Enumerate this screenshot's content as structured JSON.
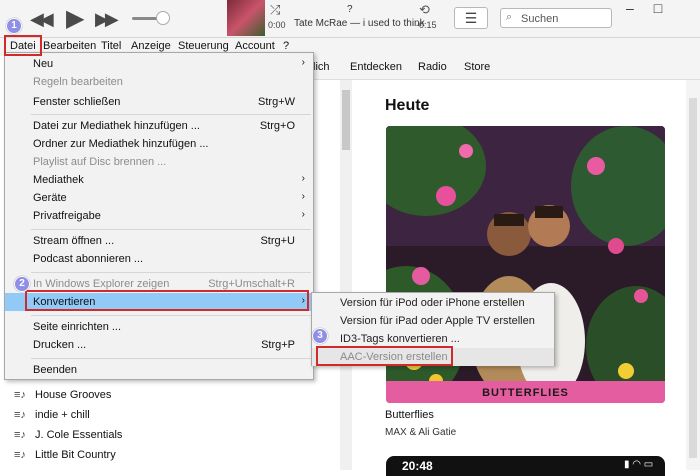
{
  "player": {
    "now_playing": "Tate McRae — i used to think",
    "track_status": "?",
    "elapsed": "0:00",
    "remaining": "-0:15",
    "search_placeholder": "Suchen"
  },
  "menubar": [
    "Datei",
    "Bearbeiten",
    "Titel",
    "Anzeige",
    "Steuerung",
    "Account",
    "?"
  ],
  "nav_tabs": [
    "lich",
    "Entdecken",
    "Radio",
    "Store"
  ],
  "main": {
    "section_title": "Heute",
    "album_cover_text": "BUTTERFLIES",
    "album_title": "Butterflies",
    "album_artist": "MAX & Ali Gatie",
    "phone_time": "20:48"
  },
  "playlists": [
    "House Grooves",
    "indie + chill",
    "J. Cole Essentials",
    "Little Bit Country"
  ],
  "file_menu": {
    "items": [
      {
        "label": "Neu",
        "shortcut": "",
        "submenu": true,
        "disabled": false
      },
      {
        "label": "Regeln bearbeiten",
        "shortcut": "",
        "submenu": false,
        "disabled": true
      },
      {
        "label": "Fenster schließen",
        "shortcut": "Strg+W",
        "submenu": false,
        "disabled": false
      },
      {
        "label": "Datei zur Mediathek hinzufügen ...",
        "shortcut": "Strg+O",
        "submenu": false,
        "disabled": false
      },
      {
        "label": "Ordner zur Mediathek hinzufügen ...",
        "shortcut": "",
        "submenu": false,
        "disabled": false
      },
      {
        "label": "Playlist auf Disc brennen ...",
        "shortcut": "",
        "submenu": false,
        "disabled": true
      },
      {
        "label": "Mediathek",
        "shortcut": "",
        "submenu": true,
        "disabled": false
      },
      {
        "label": "Geräte",
        "shortcut": "",
        "submenu": true,
        "disabled": false
      },
      {
        "label": "Privatfreigabe",
        "shortcut": "",
        "submenu": true,
        "disabled": false
      },
      {
        "label": "Stream öffnen ...",
        "shortcut": "Strg+U",
        "submenu": false,
        "disabled": false
      },
      {
        "label": "Podcast abonnieren ...",
        "shortcut": "",
        "submenu": false,
        "disabled": false
      },
      {
        "label": "In Windows Explorer zeigen",
        "shortcut": "Strg+Umschalt+R",
        "submenu": false,
        "disabled": true
      },
      {
        "label": "Konvertieren",
        "shortcut": "",
        "submenu": true,
        "disabled": false,
        "highlighted": true
      },
      {
        "label": "Seite einrichten ...",
        "shortcut": "",
        "submenu": false,
        "disabled": false
      },
      {
        "label": "Drucken ...",
        "shortcut": "Strg+P",
        "submenu": false,
        "disabled": false
      },
      {
        "label": "Beenden",
        "shortcut": "",
        "submenu": false,
        "disabled": false
      }
    ]
  },
  "convert_submenu": {
    "items": [
      {
        "label": "Version für iPod oder iPhone erstellen",
        "disabled": false
      },
      {
        "label": "Version für iPad oder Apple TV erstellen",
        "disabled": false
      },
      {
        "label": "ID3-Tags konvertieren ...",
        "disabled": false
      },
      {
        "label": "AAC-Version erstellen",
        "disabled": true,
        "hover": true
      }
    ]
  },
  "steps": [
    "1",
    "2",
    "3"
  ],
  "colors": {
    "annotation_red": "#d12a2a",
    "badge": "#8f8fe6",
    "menu_highlight": "#91c9f7"
  }
}
